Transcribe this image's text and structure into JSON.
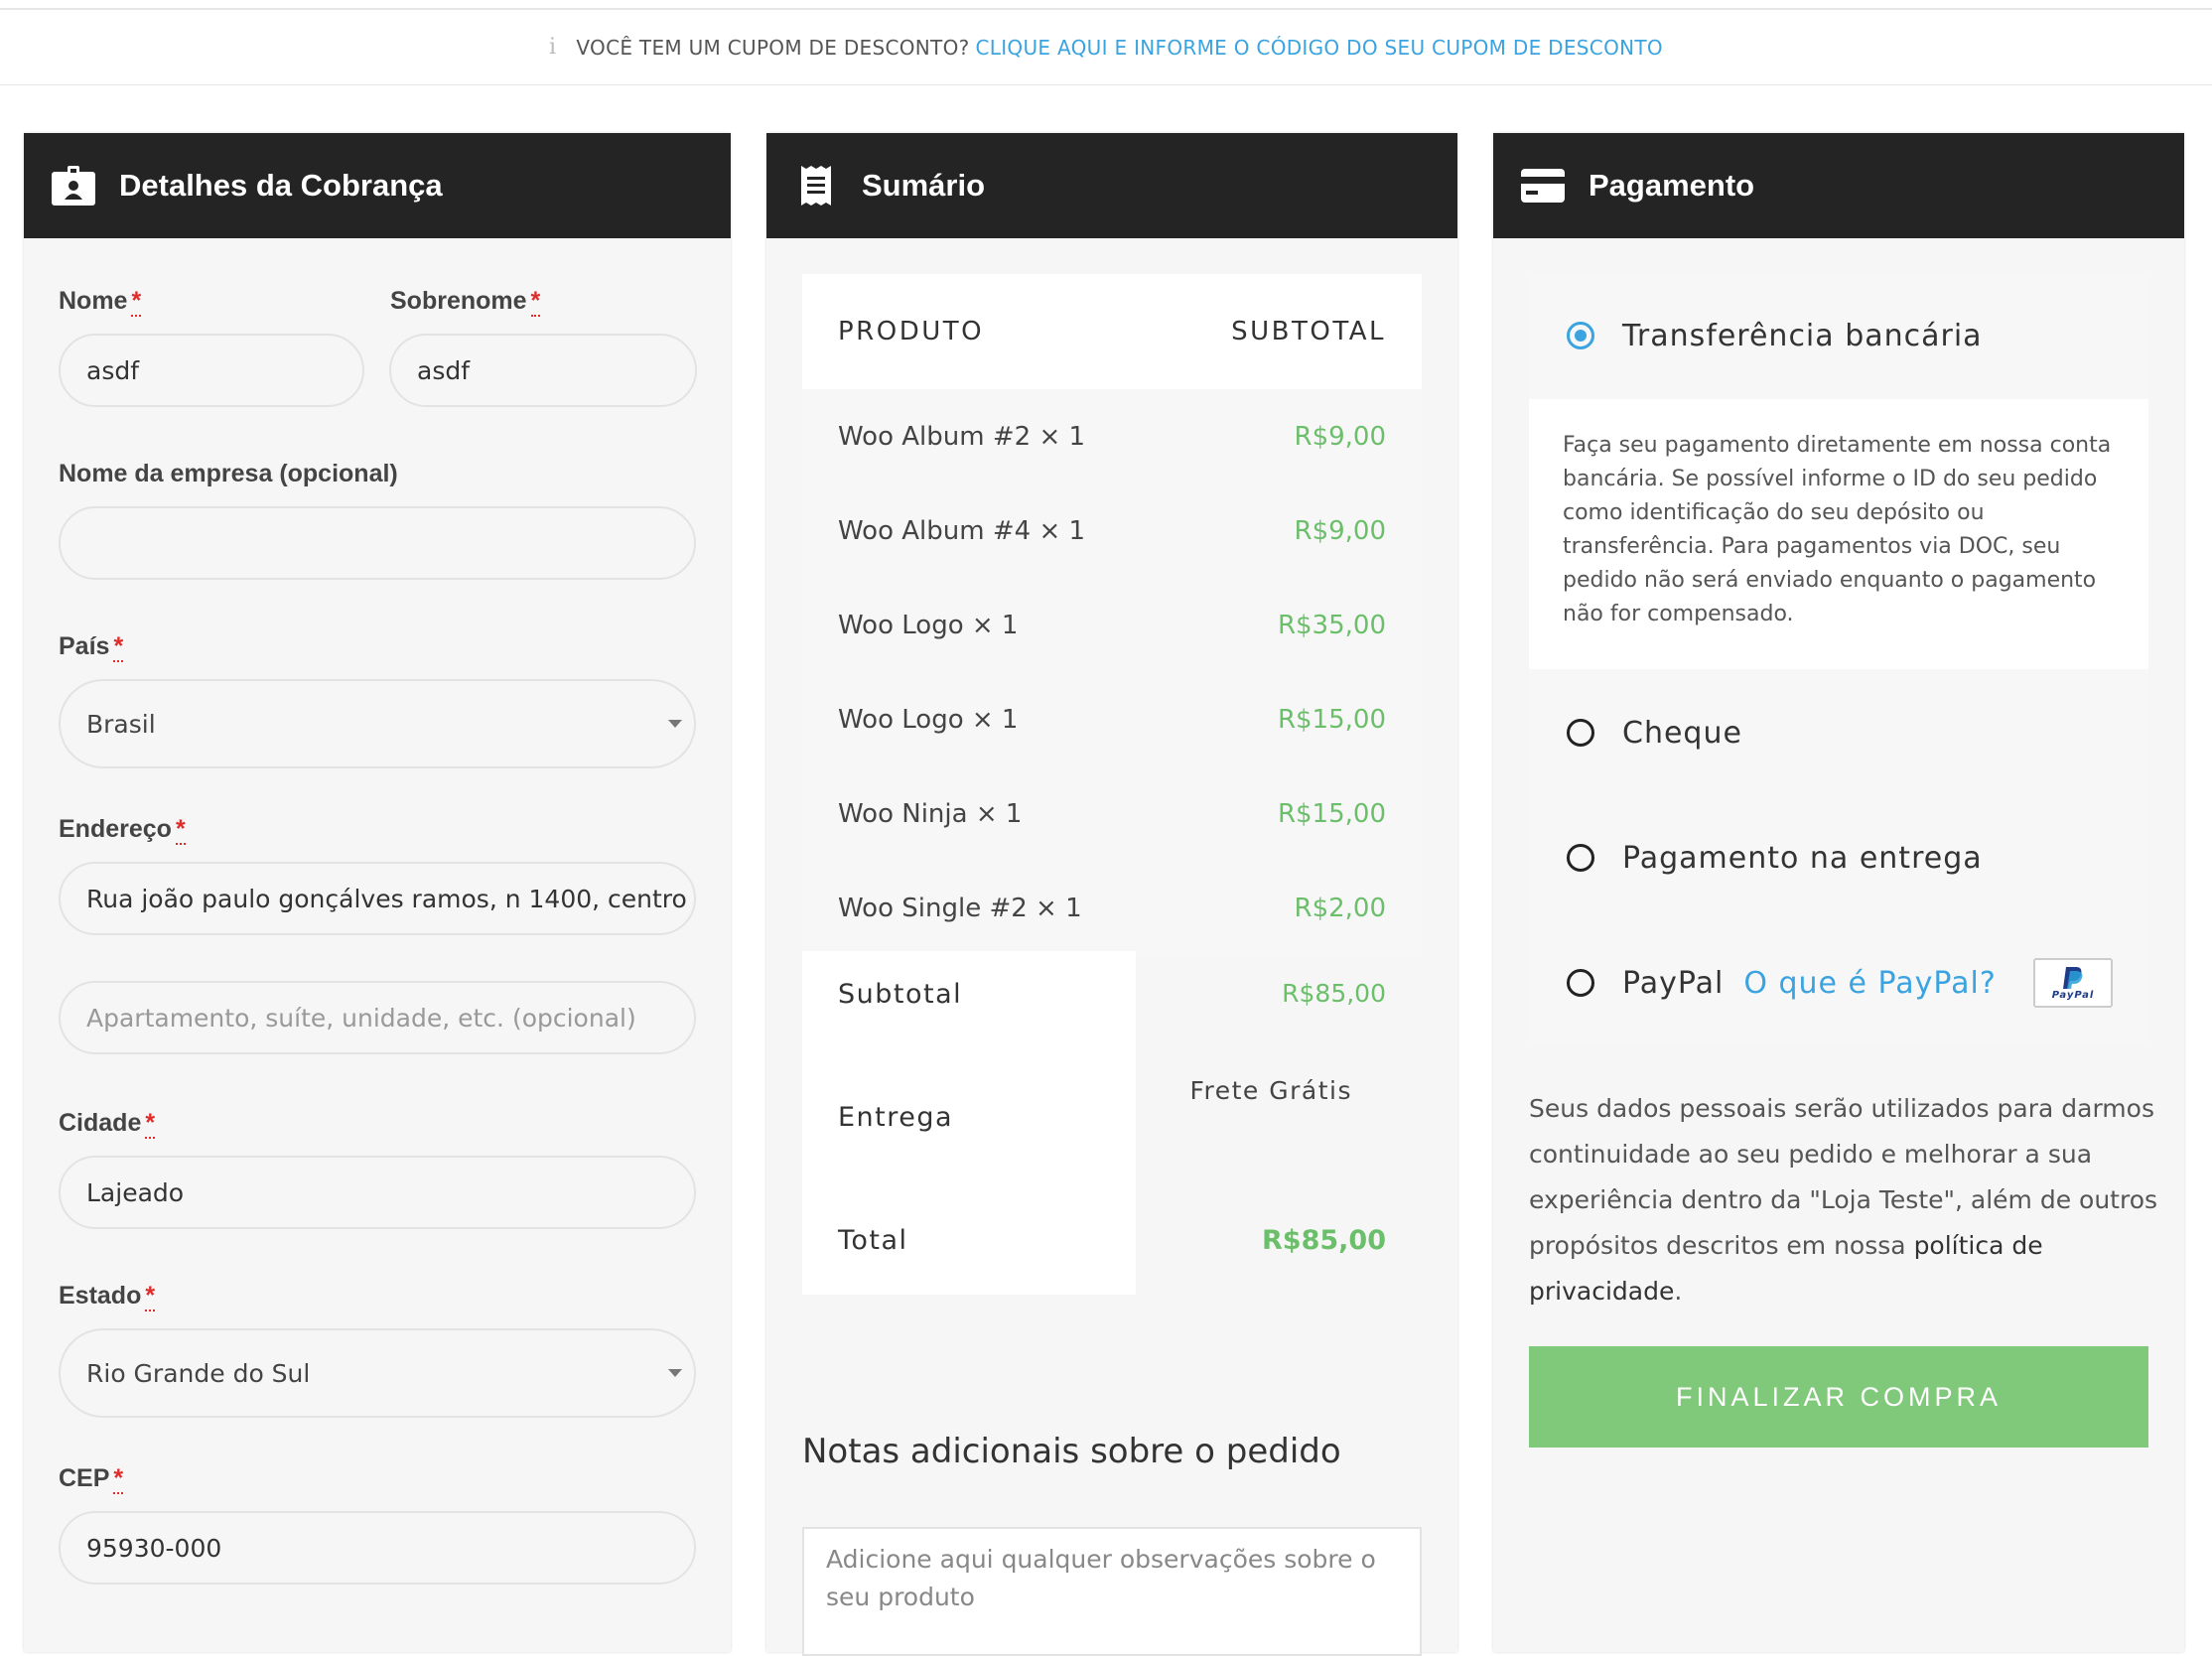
{
  "coupon": {
    "prefix": "VOCÊ TEM UM CUPOM DE DESCONTO?",
    "link": "CLIQUE AQUI E INFORME O CÓDIGO DO SEU CUPOM DE DESCONTO"
  },
  "billing": {
    "title": "Detalhes da Cobrança",
    "required_mark": "*",
    "first_name": {
      "label": "Nome",
      "value": "asdf"
    },
    "last_name": {
      "label": "Sobrenome",
      "value": "asdf"
    },
    "company": {
      "label": "Nome da empresa (opcional)",
      "value": ""
    },
    "country": {
      "label": "País",
      "value": "Brasil"
    },
    "address": {
      "label": "Endereço",
      "value": "Rua joão paulo gonçálves ramos, n 1400, centro"
    },
    "address2": {
      "placeholder": "Apartamento, suíte, unidade, etc. (opcional)"
    },
    "city": {
      "label": "Cidade",
      "value": "Lajeado"
    },
    "state": {
      "label": "Estado",
      "value": "Rio Grande do Sul"
    },
    "postcode": {
      "label": "CEP",
      "value": "95930-000"
    }
  },
  "summary": {
    "title": "Sumário",
    "col_product": "PRODUTO",
    "col_subtotal": "SUBTOTAL",
    "items": [
      {
        "name": "Woo Album #2  × 1",
        "price": "R$9,00"
      },
      {
        "name": "Woo Album #4  × 1",
        "price": "R$9,00"
      },
      {
        "name": "Woo Logo  × 1",
        "price": "R$35,00"
      },
      {
        "name": "Woo Logo  × 1",
        "price": "R$15,00"
      },
      {
        "name": "Woo Ninja  × 1",
        "price": "R$15,00"
      },
      {
        "name": "Woo Single #2  × 1",
        "price": "R$2,00"
      }
    ],
    "subtotal_label": "Subtotal",
    "subtotal_value": "R$85,00",
    "shipping_label": "Entrega",
    "shipping_value": "Frete Grátis",
    "total_label": "Total",
    "total_value": "R$85,00",
    "notes_title": "Notas adicionais sobre o pedido",
    "notes_placeholder": "Adicione aqui qualquer observações sobre o seu produto"
  },
  "payment": {
    "title": "Pagamento",
    "options": [
      {
        "label": "Transferência bancária",
        "selected": true
      },
      {
        "label": "Cheque",
        "selected": false
      },
      {
        "label": "Pagamento na entrega",
        "selected": false
      },
      {
        "label": "PayPal",
        "selected": false
      }
    ],
    "bank_description": "Faça seu pagamento diretamente em nossa conta bancária. Se possível informe o ID do seu pedido como identificação do seu depósito ou transferência. Para pagamentos via DOC, seu pedido não será enviado enquanto o pagamento não for compensado.",
    "paypal_link": "O que é PayPal?",
    "paypal_logo_text": "PayPal",
    "privacy_text": "Seus dados pessoais serão utilizados para darmos continuidade ao seu pedido e melhorar a sua experiência dentro da \"Loja Teste\", além de outros propósitos descritos em nossa ",
    "privacy_link": "política de privacidade",
    "privacy_end": ".",
    "button": "FINALIZAR COMPRA"
  },
  "colors": {
    "header_bg": "#242424",
    "accent_blue": "#3aa3e0",
    "price_green": "#6cbf6a",
    "button_green": "#80c97a",
    "required_red": "#e02b2b"
  }
}
